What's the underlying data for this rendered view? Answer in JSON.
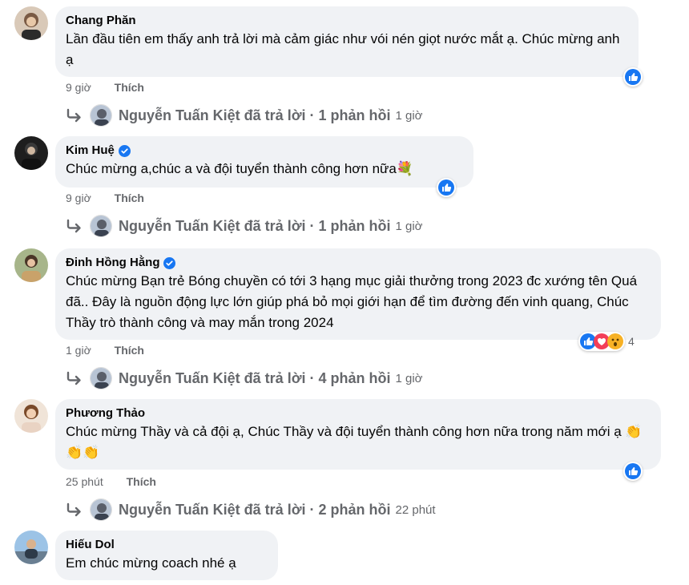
{
  "comments": [
    {
      "author": "Chang Phăn",
      "verified": false,
      "text": "Lần đầu tiên em thấy anh trả lời mà cảm giác như vói nén giọt nước mắt ạ. Chúc mừng anh ạ",
      "time": "9 giờ",
      "like_label": "Thích",
      "reactions": [
        "like"
      ],
      "reaction_count": "",
      "reply": {
        "text": "Nguyễn Tuấn Kiệt đã trả lời · 1 phản hồi",
        "time": "1 giờ"
      }
    },
    {
      "author": "Kim Huệ",
      "verified": true,
      "text": "Chúc mừng a,chúc a và đội tuyển thành công hơn nữa💐",
      "time": "9 giờ",
      "like_label": "Thích",
      "reactions": [
        "like"
      ],
      "reaction_count": "",
      "reply": {
        "text": "Nguyễn Tuấn Kiệt đã trả lời · 1 phản hồi",
        "time": "1 giờ"
      }
    },
    {
      "author": "Đinh Hồng Hằng",
      "verified": true,
      "text": "Chúc mừng Bạn trẻ Bóng chuyền có tới 3 hạng mục giải thưởng trong 2023 đc xướng tên Quá đã.. Đây là nguồn động lực lớn giúp phá bỏ mọi giới hạn để tìm đường đến vinh quang, Chúc Thầy trò thành công và may mắn trong 2024",
      "time": "1 giờ",
      "like_label": "Thích",
      "reactions": [
        "like",
        "love",
        "wow"
      ],
      "reaction_count": "4",
      "reply": {
        "text": "Nguyễn Tuấn Kiệt đã trả lời · 4 phản hồi",
        "time": "1 giờ"
      }
    },
    {
      "author": "Phương Thảo",
      "verified": false,
      "text": "Chúc mừng Thầy và cả đội ạ, Chúc Thầy và đội tuyển thành công hơn nữa trong năm mới ạ 👏👏👏",
      "time": "25 phút",
      "like_label": "Thích",
      "reactions": [
        "like"
      ],
      "reaction_count": "",
      "reply": {
        "text": "Nguyễn Tuấn Kiệt đã trả lời · 2 phản hồi",
        "time": "22 phút"
      }
    },
    {
      "author": "Hiếu Dol",
      "verified": false,
      "text": "Em chúc mừng coach nhé ạ"
    }
  ],
  "colors": {
    "like_blue": "#1877f2",
    "bubble": "#f0f2f5",
    "meta": "#65676b"
  },
  "icons": [
    "avatar",
    "verified-badge-icon",
    "like-reaction-icon",
    "love-reaction-icon",
    "wow-reaction-icon",
    "reply-arrow-icon"
  ]
}
